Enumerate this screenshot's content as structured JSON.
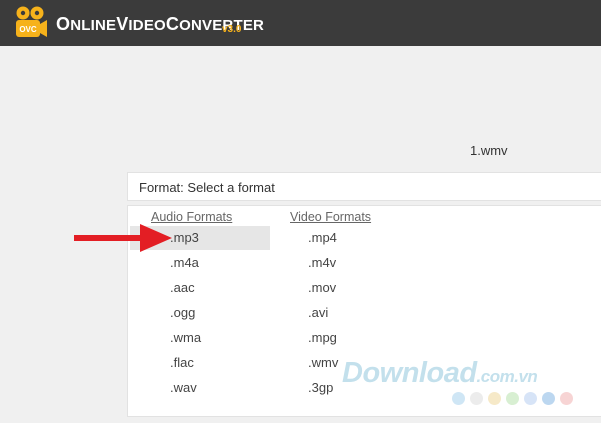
{
  "header": {
    "brand_part1_cap": "O",
    "brand_part1_rest": "NLINE",
    "brand_part2_cap": "V",
    "brand_part2_rest": "IDEO",
    "brand_part3_cap": "C",
    "brand_part3_rest": "ONVERTER",
    "version": "v3.0",
    "logo_text": "OVC"
  },
  "file": {
    "name": "1.wmv"
  },
  "format_select": {
    "label": "Format: Select a format"
  },
  "dropdown": {
    "audio": {
      "header": "Audio Formats",
      "options": [
        ".mp3",
        ".m4a",
        ".aac",
        ".ogg",
        ".wma",
        ".flac",
        ".wav"
      ],
      "selected": ".mp3"
    },
    "video": {
      "header": "Video Formats",
      "options": [
        ".mp4",
        ".m4v",
        ".mov",
        ".avi",
        ".mpg",
        ".wmv",
        ".3gp"
      ]
    }
  },
  "colors": {
    "header_bg": "#3b3b3b",
    "logo_yellow": "#f6b21b",
    "arrow_red": "#e31e24",
    "selected_bg": "#e6e6e6"
  },
  "watermark": {
    "main": "Download",
    "domain": ".com.vn",
    "dots": [
      "#cfe6f5",
      "#ececec",
      "#f6e9c8",
      "#d8efd2",
      "#d7e4f7",
      "#bcd7f0",
      "#f7d4d4"
    ]
  }
}
